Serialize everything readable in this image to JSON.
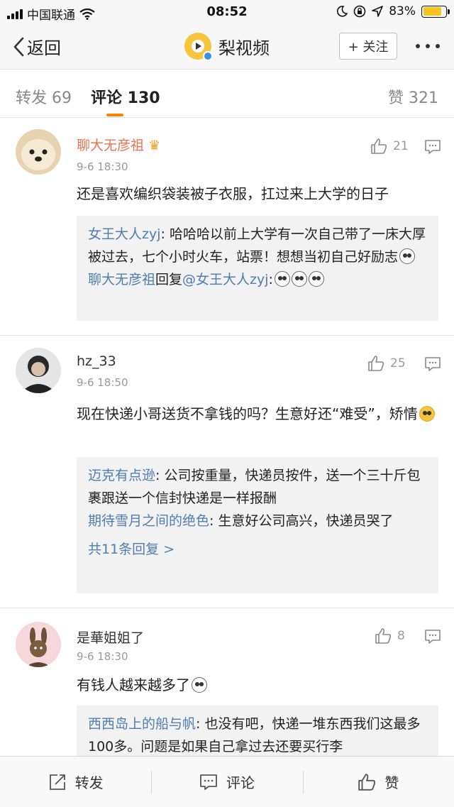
{
  "status_bar": {
    "carrier": "中国联通",
    "time": "08:52",
    "battery": "83%",
    "battery_level": 0.83
  },
  "nav": {
    "back_label": "返回",
    "title": "梨视频",
    "follow_label": "+ 关注",
    "more_icon": "more-icon"
  },
  "tabs": {
    "repost": "转发 69",
    "comment": "评论 130",
    "like": "赞 321"
  },
  "comments": [
    {
      "username": "聊大无彦祖",
      "time": "9-6 18:30",
      "likes": "21",
      "text": "还是喜欢编织袋装被子衣服，扛过来上大学的日子",
      "replies": [
        {
          "user": "女王大人zyj",
          "text": ": 哈哈哈以前上大学有一次自己带了一床大厚被过去，七个小时火车，站票！想想当初自己好励志"
        },
        {
          "user": "聊大无彦祖",
          "mid": "回复",
          "mention": "@女王大人zyj",
          "text": ":"
        }
      ]
    },
    {
      "username": "hz_33",
      "time": "9-6 18:50",
      "likes": "25",
      "text": "现在快递小哥送货不拿钱的吗？生意好还“难受”，矫情",
      "replies": [
        {
          "user": "迈克有点逊",
          "text": ": 公司按重量，快递员按件，送一个三十斤包裹跟送一个信封快递是一样报酬"
        },
        {
          "user": "期待雪月之间的绝色",
          "text": ": 生意好公司高兴，快递员哭了"
        }
      ],
      "more_replies": "共11条回复 >"
    },
    {
      "username": "是華姐姐了",
      "time": "9-6 18:30",
      "likes": "8",
      "text": "有钱人越来越多了",
      "replies": [
        {
          "user": "西西岛上的船与帆",
          "text": ": 也没有吧，快递一堆东西我们这最多100多。问题是如果自己拿过去还要买行李"
        }
      ]
    }
  ],
  "bottom_bar": {
    "repost": "转发",
    "comment": "评论",
    "like": "赞"
  }
}
